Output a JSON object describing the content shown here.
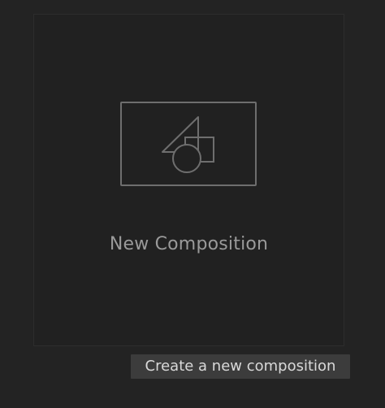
{
  "new_composition": {
    "label": "New Composition",
    "icon": "composition-shapes-icon"
  },
  "tooltip": {
    "text": "Create a new composition"
  },
  "colors": {
    "background": "#232323",
    "tile_border": "#2d2d2d",
    "icon_stroke": "#6e6e6e",
    "label_text": "#9a9a9a",
    "tooltip_bg": "#3c3c3c",
    "tooltip_text": "#d9d9d9"
  }
}
